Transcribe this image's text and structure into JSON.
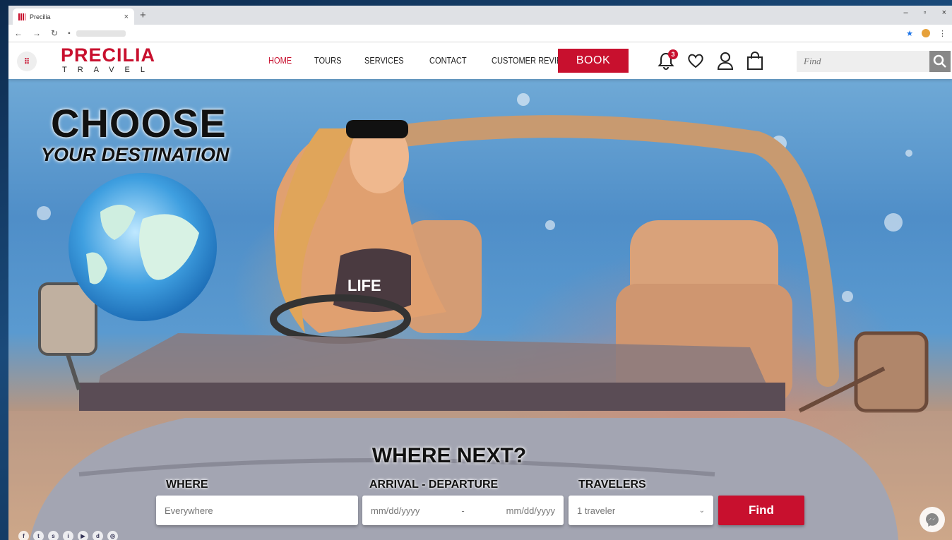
{
  "browser": {
    "tab_title": "Precilia",
    "tab_close": "×",
    "new_tab": "+",
    "window_controls": [
      "–",
      "▫",
      "×"
    ],
    "nav_icons": [
      "back-icon",
      "forward-icon",
      "reload-icon",
      "lock-icon"
    ]
  },
  "header": {
    "logo_main": "PRECILIA",
    "logo_sub": "TRAVEL",
    "nav": [
      "HOME",
      "TOURS",
      "SERVICES",
      "CONTACT",
      "CUSTOMER REVIEWS"
    ],
    "active_nav": "HOME",
    "book_label": "BOOK",
    "notification_count": "3",
    "search_placeholder": "Find"
  },
  "hero": {
    "heading_line1": "CHOOSE",
    "heading_line2": "YOUR DESTINATION",
    "where_next": "WHERE NEXT?",
    "shirt_text": "LIFE"
  },
  "booking": {
    "where_label": "WHERE",
    "where_placeholder": "Everywhere",
    "dates_label": "ARRIVAL - DEPARTURE",
    "arrival_placeholder": "mm/dd/yyyy",
    "date_separator": "-",
    "departure_placeholder": "mm/dd/yyyy",
    "travelers_label": "TRAVELERS",
    "travelers_value": "1 traveler",
    "find_label": "Find"
  },
  "social_icons": [
    "facebook-icon",
    "twitter-icon",
    "snapchat-icon",
    "instagram-icon",
    "youtube-icon",
    "dailymotion-icon",
    "tripadvisor-icon"
  ],
  "social_glyphs": [
    "f",
    "t",
    "s",
    "i",
    "▶",
    "d",
    "◎"
  ],
  "colors": {
    "brand_red": "#c8102e"
  }
}
